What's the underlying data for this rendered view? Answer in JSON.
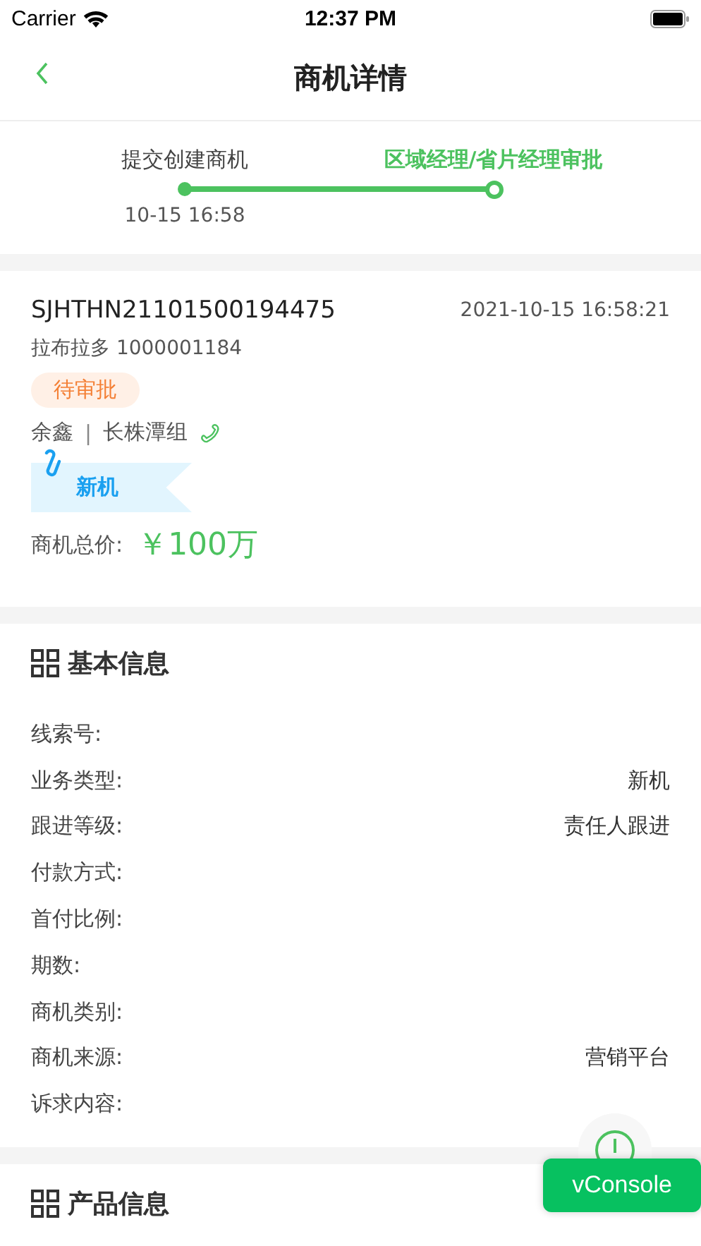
{
  "status_bar": {
    "carrier": "Carrier",
    "time": "12:37 PM"
  },
  "nav": {
    "title": "商机详情"
  },
  "progress": [
    {
      "label": "提交创建商机",
      "time": "10-15 16:58",
      "current": false
    },
    {
      "label": "区域经理/省片经理审批",
      "current": true
    }
  ],
  "card": {
    "code": "SJHTHN21101500194475",
    "datetime": "2021-10-15 16:58:21",
    "customer": "拉布拉多 1000001184",
    "status": "待审批",
    "person": "余鑫",
    "separator": "|",
    "group": "长株潭组",
    "tag": "新机",
    "price_label": "商机总价:",
    "price": "￥100万"
  },
  "basic_info": {
    "title": "基本信息",
    "rows": [
      {
        "label": "线索号:"
      },
      {
        "label": "业务类型:",
        "value": "新机"
      },
      {
        "label": "跟进等级:",
        "value": "责任人跟进"
      },
      {
        "label": "付款方式:"
      },
      {
        "label": "首付比例:"
      },
      {
        "label": "期数:"
      },
      {
        "label": "商机类别:"
      },
      {
        "label": "商机来源:",
        "value": "营销平台"
      },
      {
        "label": "诉求内容:"
      }
    ]
  },
  "product_info": {
    "title": "产品信息"
  },
  "vconsole": {
    "label": "vConsole"
  }
}
